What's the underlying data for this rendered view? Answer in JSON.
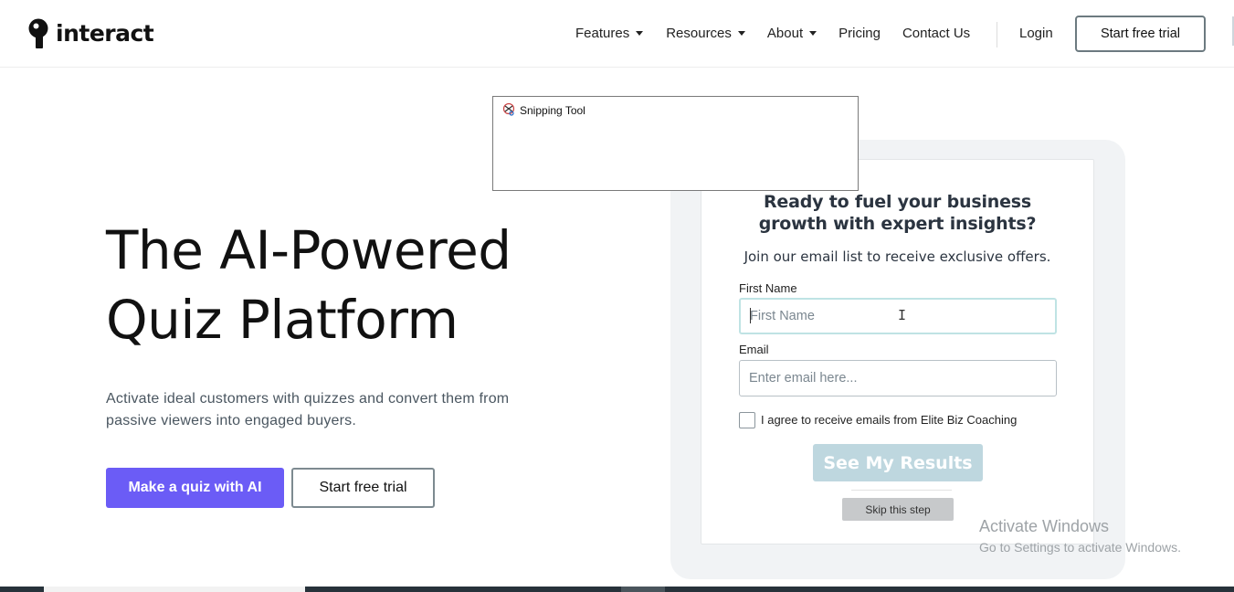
{
  "header": {
    "logo_text": "interact",
    "nav": [
      {
        "label": "Features",
        "has_dropdown": true
      },
      {
        "label": "Resources",
        "has_dropdown": true
      },
      {
        "label": "About",
        "has_dropdown": true
      },
      {
        "label": "Pricing",
        "has_dropdown": false
      },
      {
        "label": "Contact Us",
        "has_dropdown": false
      }
    ],
    "login_label": "Login",
    "trial_label": "Start free trial"
  },
  "hero": {
    "title_line1": "The AI-Powered",
    "title_line2": "Quiz Platform",
    "subtitle": "Activate ideal customers with quizzes and convert them from passive viewers into engaged buyers.",
    "primary_button": "Make a quiz with AI",
    "secondary_button": "Start free trial"
  },
  "quiz_card": {
    "heading": "Ready to fuel your business growth with expert insights?",
    "subheading": "Join our email list to receive exclusive offers.",
    "first_name_label": "First Name",
    "first_name_placeholder": "First Name",
    "email_label": "Email",
    "email_placeholder": "Enter email here...",
    "agree_label": "I agree to receive emails from Elite Biz Coaching",
    "results_button": "See My Results",
    "skip_button": "Skip this step"
  },
  "snipping_tool": {
    "title": "Snipping Tool"
  },
  "watermark": {
    "title": "Activate Windows",
    "subtitle": "Go to Settings to activate Windows."
  },
  "colors": {
    "primary": "#6b5cf6",
    "results_button": "#bed7df",
    "text_dark": "#111111"
  }
}
